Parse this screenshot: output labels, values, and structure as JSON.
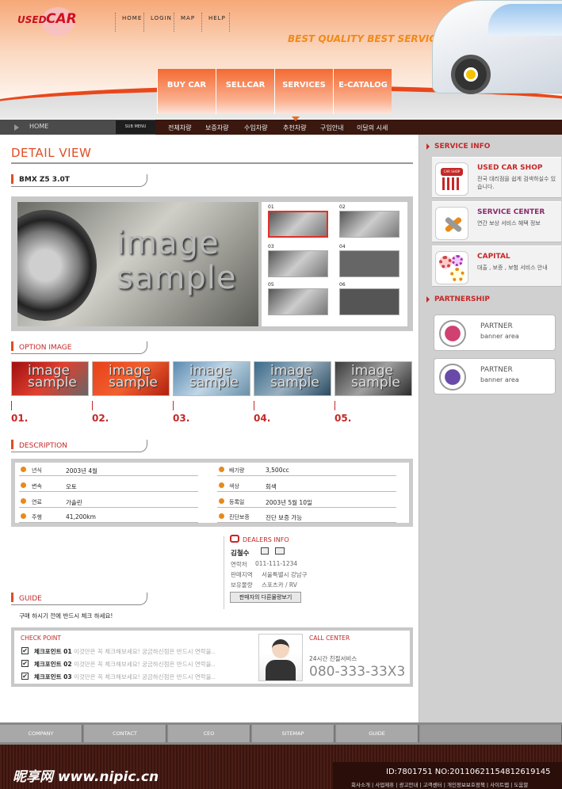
{
  "logo": {
    "used": "USED",
    "car": "CAR"
  },
  "top_links": [
    "HOME",
    "LOGIN",
    "MAP",
    "HELP"
  ],
  "slogan": "BEST QUALITY BEST SERVICE",
  "main_nav": [
    "BUY CAR",
    "SELLCAR",
    "SERVICES",
    "E-CATALOG"
  ],
  "breadcrumb": {
    "home": "HOME",
    "submenu": "SUB MENU"
  },
  "sub_nav": [
    "전체차량",
    "보증차량",
    "수입차량",
    "추천차량",
    "구입안내",
    "이달의 시세"
  ],
  "detail": {
    "title": "DETAIL VIEW",
    "model": "BMX Z5 3.0T",
    "image_text_1": "image",
    "image_text_2": "sample",
    "thumb_nums": [
      "01",
      "02",
      "03",
      "04",
      "05",
      "06"
    ]
  },
  "option": {
    "title": "OPTION IMAGE",
    "img_text_1": "image",
    "img_text_2": "sample",
    "nums": [
      "01.",
      "02.",
      "03.",
      "04.",
      "05."
    ]
  },
  "description": {
    "title": "DESCRIPTION",
    "left": [
      {
        "k": "년식",
        "v": "2003년 4월"
      },
      {
        "k": "변속",
        "v": "오토"
      },
      {
        "k": "연료",
        "v": "가솔린"
      },
      {
        "k": "주행",
        "v": "41,200km"
      }
    ],
    "right": [
      {
        "k": "배기량",
        "v": "3,500cc"
      },
      {
        "k": "색상",
        "v": "회색"
      },
      {
        "k": "등록일",
        "v": "2003년 5월 10일"
      },
      {
        "k": "진단보증",
        "v": "진단 보증 가능"
      }
    ]
  },
  "dealers": {
    "title": "DEALERS INFO",
    "name": "김철수",
    "rows": [
      {
        "k": "연락처",
        "v": "011-111-1234"
      },
      {
        "k": "판매지역",
        "v": "서울특별시 강남구"
      },
      {
        "k": "보유물량",
        "v": "스포츠카 / RV"
      }
    ],
    "button": "판매자의 다른물량보기"
  },
  "guide": {
    "title": "GUIDE",
    "text": "구매 하시기 전에 반드시 체크 하세요!"
  },
  "check": {
    "title": "CHECK POINT",
    "items": [
      {
        "label": "체크포인트 01",
        "text": "이것만은 꼭 체크해보세요! 궁금하신점은 반드시 연락을.."
      },
      {
        "label": "체크포인트 02",
        "text": "이것만은 꼭 체크해보세요! 궁금하신점은 반드시 연락을.."
      },
      {
        "label": "체크포인트 03",
        "text": "이것만은 꼭 체크해보세요! 궁금하신점은 반드시 연락을.."
      }
    ],
    "call_title": "CALL CENTER",
    "call_sub": "24시간 친절서비스",
    "call_number": "080-333-33X3"
  },
  "sidebar": {
    "service_title": "SERVICE INFO",
    "services": [
      {
        "title": "USED CAR SHOP",
        "desc": "전국 대리점을 쉽게 검색하실수 있습니다.",
        "color": "#c42828",
        "icon_text": "CAR SHOP"
      },
      {
        "title": "SERVICE CENTER",
        "desc": "연간 보상 서비스 혜택 정보",
        "color": "#8a2a6a",
        "icon_text": ""
      },
      {
        "title": "CAPITAL",
        "desc": "대출 , 보증 , 보험 서비스 안내",
        "color": "#c42828",
        "icon_text": ""
      }
    ],
    "partner_title": "PARTNERSHIP",
    "partners": [
      {
        "t1": "PARTNER",
        "t2": "banner area"
      },
      {
        "t1": "PARTNER",
        "t2": "banner area"
      }
    ]
  },
  "footer_nav": [
    "COMPANY",
    "CONTACT",
    "CEO",
    "SITEMAP",
    "GUIDE"
  ],
  "footer": {
    "watermark": "昵享网 www.nipic.cn",
    "id_line": "ID:7801751 NO:20110621154812619145",
    "links": "회사소개 | 사업제휴 | 광고안내 | 고객센터 | 개인정보보호정책 | 사이트맵 | 도움말"
  }
}
